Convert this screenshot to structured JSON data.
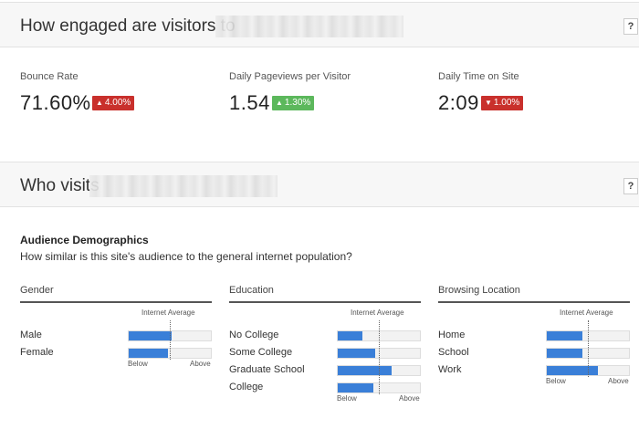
{
  "engagement": {
    "title": "How engaged are visitors to",
    "help": "?",
    "metrics": [
      {
        "label": "Bounce Rate",
        "value": "71.60%",
        "change": "4.00%",
        "direction": "up",
        "color": "#c9302c"
      },
      {
        "label": "Daily Pageviews per Visitor",
        "value": "1.54",
        "change": "1.30%",
        "direction": "up",
        "color": "#5cb85c"
      },
      {
        "label": "Daily Time on Site",
        "value": "2:09",
        "change": "1.00%",
        "direction": "down",
        "color": "#c9302c"
      }
    ]
  },
  "visits": {
    "title": "Who visits",
    "help": "?"
  },
  "demographics": {
    "title": "Audience Demographics",
    "subtitle": "How similar is this site's audience to the general internet population?",
    "internet_average_label": "Internet Average",
    "below_label": "Below",
    "above_label": "Above",
    "columns": [
      {
        "heading": "Gender",
        "rows": [
          {
            "label": "Male",
            "fill": 0.52
          },
          {
            "label": "Female",
            "fill": 0.48
          }
        ]
      },
      {
        "heading": "Education",
        "rows": [
          {
            "label": "No College",
            "fill": 0.3
          },
          {
            "label": "Some College",
            "fill": 0.46
          },
          {
            "label": "Graduate School",
            "fill": 0.66
          },
          {
            "label": "College",
            "fill": 0.43
          }
        ]
      },
      {
        "heading": "Browsing Location",
        "rows": [
          {
            "label": "Home",
            "fill": 0.43
          },
          {
            "label": "School",
            "fill": 0.43
          },
          {
            "label": "Work",
            "fill": 0.62
          }
        ]
      }
    ]
  }
}
